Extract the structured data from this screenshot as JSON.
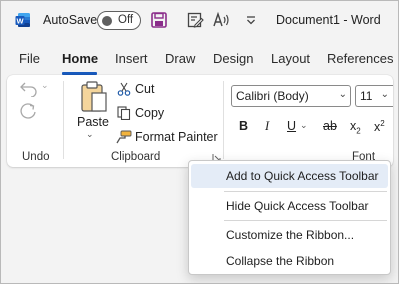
{
  "titlebar": {
    "autosave_label": "AutoSave",
    "autosave_state": "Off",
    "document_title": "Document1  -  Word"
  },
  "icons": {
    "app": "word-logo-icon",
    "save": "save-icon",
    "editor": "editor-icon",
    "read_aloud": "read-aloud-icon",
    "customize": "customize-qat-icon"
  },
  "tabs": [
    {
      "label": "File"
    },
    {
      "label": "Home"
    },
    {
      "label": "Insert"
    },
    {
      "label": "Draw"
    },
    {
      "label": "Design"
    },
    {
      "label": "Layout"
    },
    {
      "label": "References"
    }
  ],
  "ribbon": {
    "undo": {
      "group_label": "Undo"
    },
    "clipboard": {
      "paste_label": "Paste",
      "cut_label": "Cut",
      "copy_label": "Copy",
      "format_painter_label": "Format Painter",
      "group_label": "Clipboard"
    },
    "font": {
      "font_name": "Calibri (Body)",
      "font_size": "11",
      "bold": "B",
      "italic": "I",
      "underline": "U",
      "strikethrough": "ab",
      "subscript": "x",
      "subscript_mark": "2",
      "superscript": "x",
      "superscript_mark": "2",
      "group_label": "Font"
    }
  },
  "context_menu": {
    "items": [
      {
        "label": "Add to Quick Access Toolbar",
        "highlighted": true
      },
      {
        "label": "Hide Quick Access Toolbar"
      },
      {
        "label": "Customize the Ribbon..."
      },
      {
        "label": "Collapse the Ribbon"
      }
    ]
  },
  "colors": {
    "accent": "#185abd",
    "save_icon": "#8a2c8a",
    "menu_hover": "#e4ecf7"
  }
}
